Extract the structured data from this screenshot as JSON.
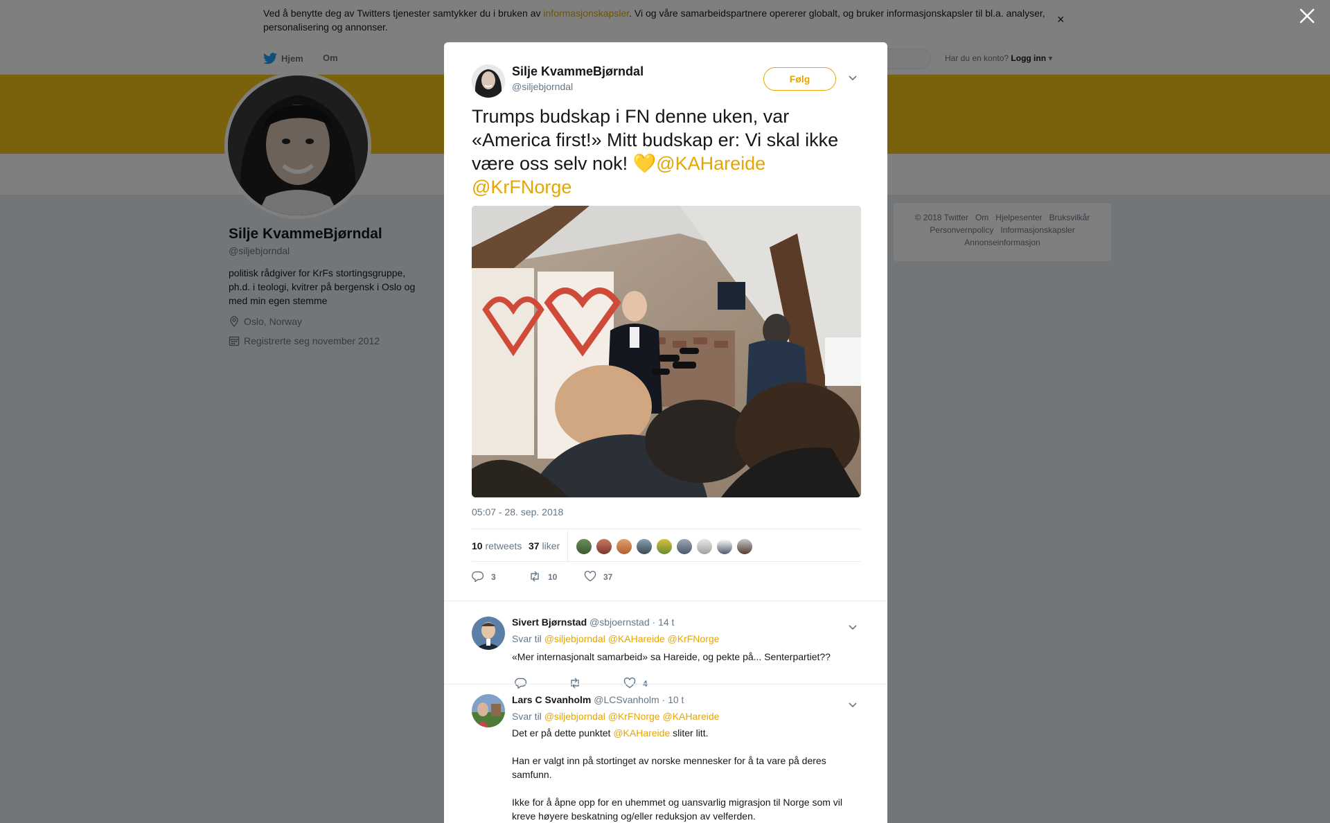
{
  "cookie_bar": {
    "text_before": "Ved å benytte deg av Twitters tjenester samtykker du i bruken av ",
    "link": "informasjonskapsler",
    "text_after": ". Vi og våre samarbeidspartnere opererer globalt, og bruker informasjonskapsler til bl.a. analyser, personalisering og annonser.",
    "close": "×"
  },
  "nav": {
    "home": "Hjem",
    "about": "Om",
    "account_prompt": "Har du en konto?",
    "login": "Logg inn"
  },
  "profile": {
    "name": "Silje KvammeBjørndal",
    "handle": "@siljebjorndal",
    "bio": "politisk rådgiver for KrFs stortingsgruppe, ph.d. i teologi, kvitrer på bergensk i Oslo og med min egen stemme",
    "location": "Oslo, Norway",
    "joined": "Registrerte seg november 2012"
  },
  "footer": {
    "items": [
      "© 2018 Twitter",
      "Om",
      "Hjelpesenter",
      "Bruksvilkår",
      "Personvernpolicy",
      "Informasjonskapsler",
      "Annonseinformasjon"
    ]
  },
  "tweet": {
    "author_name": "Silje KvammeBjørndal",
    "author_handle": "@siljebjorndal",
    "follow_label": "Følg",
    "text": "Trumps budskap i FN denne uken, var «America first!» Mitt budskap er: Vi skal ikke være oss selv nok! ",
    "emoji": "💛",
    "mention1": "@KAHareide",
    "mention2": "@KrFNorge",
    "timestamp": "05:07 - 28. sep. 2018",
    "retweets_count": "10",
    "retweets_label": "retweets",
    "likes_count": "37",
    "likes_label": "liker",
    "reply_count": "3",
    "retweet_count_action": "10",
    "like_count_action": "37"
  },
  "replies": [
    {
      "name": "Sivert Bjørnstad",
      "handle": "@sbjoernstad",
      "time": "· 14 t",
      "reply_to_label": "Svar til",
      "reply_to": "@siljebjorndal @KAHareide @KrFNorge",
      "text": "«Mer internasjonalt samarbeid» sa Hareide, og pekte på... Senterpartiet??",
      "likes": "4"
    },
    {
      "name": "Lars C Svanholm",
      "handle": "@LCSvanholm",
      "time": "· 10 t",
      "reply_to_label": "Svar til",
      "reply_to": "@siljebjorndal @KrFNorge @KAHareide",
      "text_before": "Det er på dette punktet ",
      "text_mention": "@KAHareide",
      "text_after": " sliter litt.",
      "paragraph2": "Han er valgt inn på stortinget av norske mennesker for å ta vare på deres samfunn.",
      "paragraph3": "Ikke for å åpne opp for en uhemmet og uansvarlig migrasjon til Norge som vil kreve høyere beskatning og/eller reduksjon av velferden."
    }
  ],
  "colors": {
    "accent": "#e5a600",
    "banner": "#f5c218",
    "twitter_blue": "#1da1f2"
  }
}
